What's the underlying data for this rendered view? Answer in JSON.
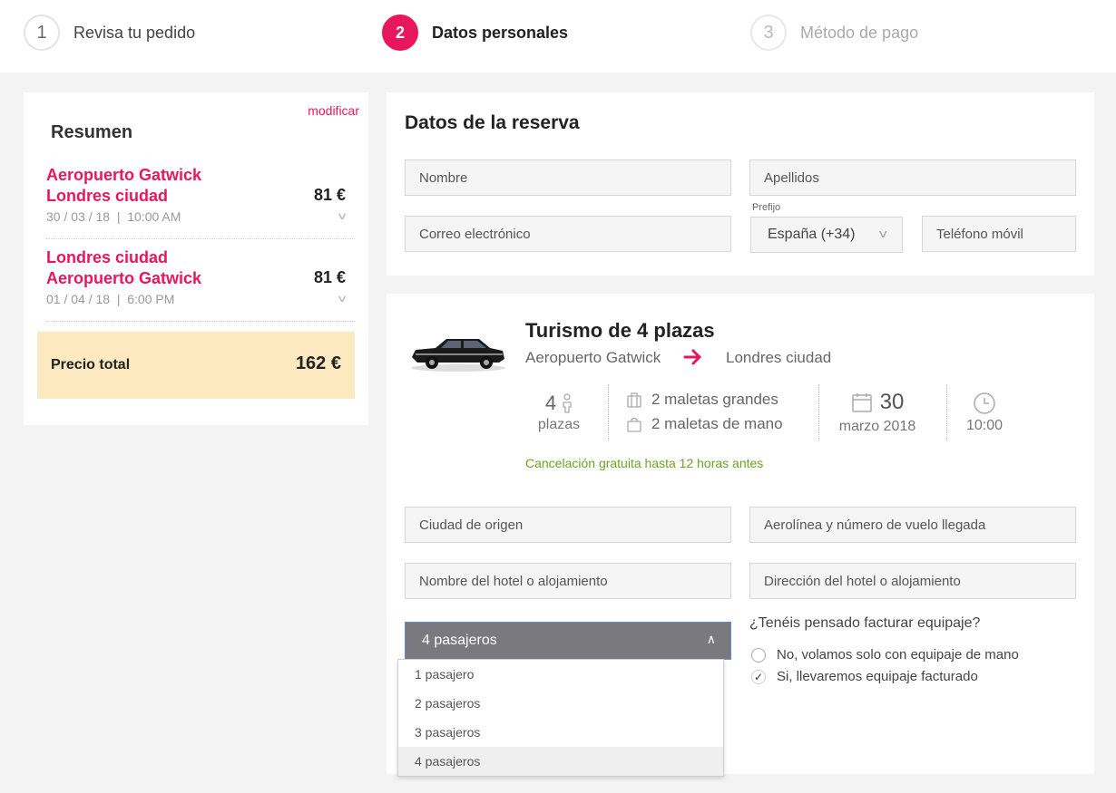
{
  "stepper": {
    "steps": [
      {
        "number": "1",
        "label": "Revisa tu pedido"
      },
      {
        "number": "2",
        "label": "Datos personales"
      },
      {
        "number": "3",
        "label": "Método de pago"
      }
    ]
  },
  "summary": {
    "modify": "modificar",
    "title": "Resumen",
    "trips": [
      {
        "origin": "Aeropuerto Gatwick",
        "destination": "Londres ciudad",
        "price": "81 €",
        "when": "30 / 03 / 18  |  10:00 AM"
      },
      {
        "origin": "Londres ciudad",
        "destination": "Aeropuerto Gatwick",
        "price": "81 €",
        "when": "01 / 04 / 18  |  6:00 PM"
      }
    ],
    "total_label": "Precio total",
    "total_amount": "162 €"
  },
  "reservation": {
    "title": "Datos de la reserva",
    "name_placeholder": "Nombre",
    "surname_placeholder": "Apellidos",
    "email_placeholder": "Correo electrónico",
    "prefix_label": "Prefijo",
    "prefix_value": "España (+34)",
    "phone_placeholder": "Teléfono móvil"
  },
  "vehicle": {
    "title": "Turismo de 4 plazas",
    "from": "Aeropuerto Gatwick",
    "to": "Londres ciudad",
    "seats_number": "4",
    "seats_label": "plazas",
    "large_bags": "2 maletas grandes",
    "hand_bags": "2 maletas de mano",
    "day": "30",
    "month_year": "marzo 2018",
    "time": "10:00",
    "cancellation": "Cancelación gratuita hasta 12 horas antes"
  },
  "trip_form": {
    "origin_city_placeholder": "Ciudad de origen",
    "flight_placeholder": "Aerolínea y número de vuelo llegada",
    "hotel_name_placeholder": "Nombre del hotel o alojamiento",
    "hotel_address_placeholder": "Dirección del hotel o alojamiento",
    "passengers_selected": "4 pasajeros",
    "passenger_options": [
      "1 pasajero",
      "2 pasajeros",
      "3 pasajeros",
      "4 pasajeros"
    ],
    "luggage_question": "¿Tenéis pensado facturar equipaje?",
    "luggage_options": [
      "No, volamos solo con equipaje de mano",
      "Si, llevaremos equipaje facturado"
    ]
  },
  "colors": {
    "accent": "#e8175d",
    "total_bg": "#fde9bf",
    "success": "#6aa520"
  }
}
